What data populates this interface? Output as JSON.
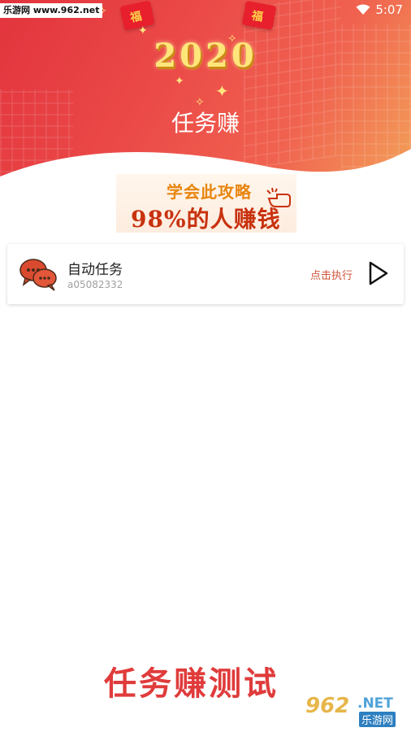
{
  "watermark": {
    "top_text": "乐游网 www.962.net",
    "bottom_number": "962",
    "bottom_domain": ".NET",
    "bottom_cn": "乐游网"
  },
  "status_bar": {
    "time": "5:07"
  },
  "hero": {
    "year": "2020",
    "title": "任务赚",
    "packet_char": "福"
  },
  "banner": {
    "line1": "学会此攻略",
    "line2": "98%的人赚钱"
  },
  "task_card": {
    "title": "自动任务",
    "subtitle": "a05082332",
    "action": "点击执行",
    "icon": "chat-bubbles-icon",
    "play_icon": "play-icon"
  },
  "footer": {
    "big_text": "任务赚测试"
  },
  "colors": {
    "hero_start": "#e2343d",
    "hero_end": "#f3a35a",
    "accent_red": "#e03b3b",
    "action": "#d0533a"
  }
}
